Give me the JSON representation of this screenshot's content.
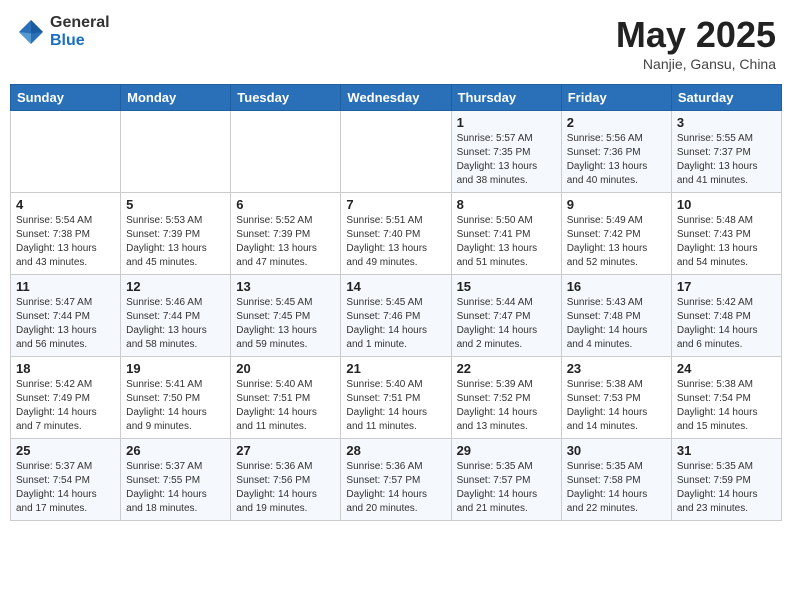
{
  "header": {
    "logo_general": "General",
    "logo_blue": "Blue",
    "month_title": "May 2025",
    "location": "Nanjie, Gansu, China"
  },
  "weekdays": [
    "Sunday",
    "Monday",
    "Tuesday",
    "Wednesday",
    "Thursday",
    "Friday",
    "Saturday"
  ],
  "weeks": [
    [
      {
        "day": "",
        "info": ""
      },
      {
        "day": "",
        "info": ""
      },
      {
        "day": "",
        "info": ""
      },
      {
        "day": "",
        "info": ""
      },
      {
        "day": "1",
        "info": "Sunrise: 5:57 AM\nSunset: 7:35 PM\nDaylight: 13 hours\nand 38 minutes."
      },
      {
        "day": "2",
        "info": "Sunrise: 5:56 AM\nSunset: 7:36 PM\nDaylight: 13 hours\nand 40 minutes."
      },
      {
        "day": "3",
        "info": "Sunrise: 5:55 AM\nSunset: 7:37 PM\nDaylight: 13 hours\nand 41 minutes."
      }
    ],
    [
      {
        "day": "4",
        "info": "Sunrise: 5:54 AM\nSunset: 7:38 PM\nDaylight: 13 hours\nand 43 minutes."
      },
      {
        "day": "5",
        "info": "Sunrise: 5:53 AM\nSunset: 7:39 PM\nDaylight: 13 hours\nand 45 minutes."
      },
      {
        "day": "6",
        "info": "Sunrise: 5:52 AM\nSunset: 7:39 PM\nDaylight: 13 hours\nand 47 minutes."
      },
      {
        "day": "7",
        "info": "Sunrise: 5:51 AM\nSunset: 7:40 PM\nDaylight: 13 hours\nand 49 minutes."
      },
      {
        "day": "8",
        "info": "Sunrise: 5:50 AM\nSunset: 7:41 PM\nDaylight: 13 hours\nand 51 minutes."
      },
      {
        "day": "9",
        "info": "Sunrise: 5:49 AM\nSunset: 7:42 PM\nDaylight: 13 hours\nand 52 minutes."
      },
      {
        "day": "10",
        "info": "Sunrise: 5:48 AM\nSunset: 7:43 PM\nDaylight: 13 hours\nand 54 minutes."
      }
    ],
    [
      {
        "day": "11",
        "info": "Sunrise: 5:47 AM\nSunset: 7:44 PM\nDaylight: 13 hours\nand 56 minutes."
      },
      {
        "day": "12",
        "info": "Sunrise: 5:46 AM\nSunset: 7:44 PM\nDaylight: 13 hours\nand 58 minutes."
      },
      {
        "day": "13",
        "info": "Sunrise: 5:45 AM\nSunset: 7:45 PM\nDaylight: 13 hours\nand 59 minutes."
      },
      {
        "day": "14",
        "info": "Sunrise: 5:45 AM\nSunset: 7:46 PM\nDaylight: 14 hours\nand 1 minute."
      },
      {
        "day": "15",
        "info": "Sunrise: 5:44 AM\nSunset: 7:47 PM\nDaylight: 14 hours\nand 2 minutes."
      },
      {
        "day": "16",
        "info": "Sunrise: 5:43 AM\nSunset: 7:48 PM\nDaylight: 14 hours\nand 4 minutes."
      },
      {
        "day": "17",
        "info": "Sunrise: 5:42 AM\nSunset: 7:48 PM\nDaylight: 14 hours\nand 6 minutes."
      }
    ],
    [
      {
        "day": "18",
        "info": "Sunrise: 5:42 AM\nSunset: 7:49 PM\nDaylight: 14 hours\nand 7 minutes."
      },
      {
        "day": "19",
        "info": "Sunrise: 5:41 AM\nSunset: 7:50 PM\nDaylight: 14 hours\nand 9 minutes."
      },
      {
        "day": "20",
        "info": "Sunrise: 5:40 AM\nSunset: 7:51 PM\nDaylight: 14 hours\nand 11 minutes."
      },
      {
        "day": "21",
        "info": "Sunrise: 5:40 AM\nSunset: 7:51 PM\nDaylight: 14 hours\nand 11 minutes."
      },
      {
        "day": "22",
        "info": "Sunrise: 5:39 AM\nSunset: 7:52 PM\nDaylight: 14 hours\nand 13 minutes."
      },
      {
        "day": "23",
        "info": "Sunrise: 5:38 AM\nSunset: 7:53 PM\nDaylight: 14 hours\nand 14 minutes."
      },
      {
        "day": "24",
        "info": "Sunrise: 5:38 AM\nSunset: 7:54 PM\nDaylight: 14 hours\nand 15 minutes."
      }
    ],
    [
      {
        "day": "25",
        "info": "Sunrise: 5:37 AM\nSunset: 7:54 PM\nDaylight: 14 hours\nand 17 minutes."
      },
      {
        "day": "26",
        "info": "Sunrise: 5:37 AM\nSunset: 7:55 PM\nDaylight: 14 hours\nand 18 minutes."
      },
      {
        "day": "27",
        "info": "Sunrise: 5:36 AM\nSunset: 7:56 PM\nDaylight: 14 hours\nand 19 minutes."
      },
      {
        "day": "28",
        "info": "Sunrise: 5:36 AM\nSunset: 7:57 PM\nDaylight: 14 hours\nand 20 minutes."
      },
      {
        "day": "29",
        "info": "Sunrise: 5:35 AM\nSunset: 7:57 PM\nDaylight: 14 hours\nand 21 minutes."
      },
      {
        "day": "30",
        "info": "Sunrise: 5:35 AM\nSunset: 7:58 PM\nDaylight: 14 hours\nand 22 minutes."
      },
      {
        "day": "31",
        "info": "Sunrise: 5:35 AM\nSunset: 7:59 PM\nDaylight: 14 hours\nand 23 minutes."
      }
    ]
  ]
}
